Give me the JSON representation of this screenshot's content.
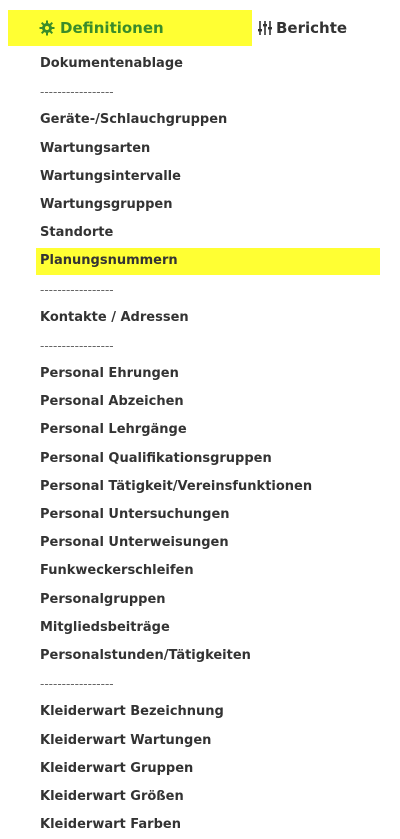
{
  "tabs": {
    "definitionen": {
      "label": "Definitionen",
      "icon": "gear-icon",
      "color": "#3a8c2a",
      "highlight": "#ffff33"
    },
    "berichte": {
      "label": "Berichte",
      "icon": "sliders-icon"
    }
  },
  "menu": {
    "items": [
      {
        "label": "Dokumentenablage",
        "kind": "link"
      },
      {
        "label": "-----------------",
        "kind": "sep"
      },
      {
        "label": "Geräte-/Schlauchgruppen",
        "kind": "link"
      },
      {
        "label": "Wartungsarten",
        "kind": "link"
      },
      {
        "label": "Wartungsintervalle",
        "kind": "link"
      },
      {
        "label": "Wartungsgruppen",
        "kind": "link"
      },
      {
        "label": "Standorte",
        "kind": "link"
      },
      {
        "label": "Planungsnummern",
        "kind": "link",
        "highlight": true
      },
      {
        "label": "-----------------",
        "kind": "sep"
      },
      {
        "label": "Kontakte / Adressen",
        "kind": "link"
      },
      {
        "label": "-----------------",
        "kind": "sep"
      },
      {
        "label": "Personal Ehrungen",
        "kind": "link"
      },
      {
        "label": "Personal Abzeichen",
        "kind": "link"
      },
      {
        "label": "Personal Lehrgänge",
        "kind": "link"
      },
      {
        "label": "Personal Qualifikationsgruppen",
        "kind": "link"
      },
      {
        "label": "Personal Tätigkeit/Vereinsfunktionen",
        "kind": "link"
      },
      {
        "label": "Personal Untersuchungen",
        "kind": "link"
      },
      {
        "label": "Personal Unterweisungen",
        "kind": "link"
      },
      {
        "label": "Funkweckerschleifen",
        "kind": "link"
      },
      {
        "label": "Personalgruppen",
        "kind": "link"
      },
      {
        "label": "Mitgliedsbeiträge",
        "kind": "link"
      },
      {
        "label": "Personalstunden/Tätigkeiten",
        "kind": "link"
      },
      {
        "label": "-----------------",
        "kind": "sep"
      },
      {
        "label": "Kleiderwart Bezeichnung",
        "kind": "link"
      },
      {
        "label": "Kleiderwart Wartungen",
        "kind": "link"
      },
      {
        "label": "Kleiderwart Gruppen",
        "kind": "link"
      },
      {
        "label": "Kleiderwart Größen",
        "kind": "link"
      },
      {
        "label": "Kleiderwart Farben",
        "kind": "link"
      }
    ]
  }
}
